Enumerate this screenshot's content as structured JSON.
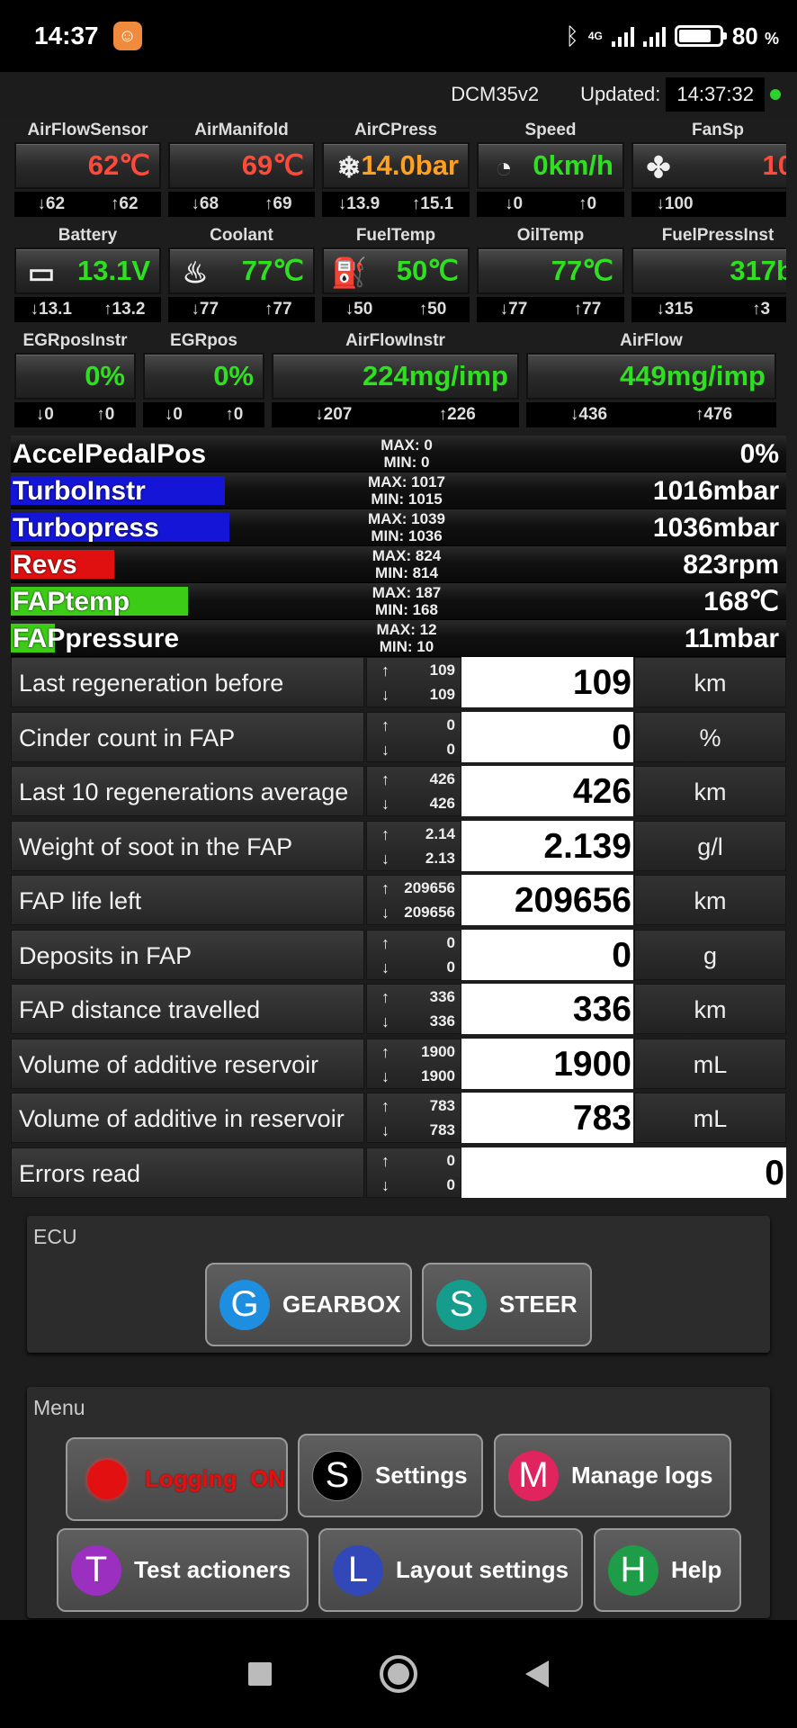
{
  "status_bar": {
    "time": "14:37",
    "app_icon": "orange-app-icon",
    "signal": "4G",
    "battery": "80",
    "battery_unit": "%"
  },
  "header": {
    "device": "DCM35v2",
    "updated_label": "Updated:",
    "updated_time": "14:37:32"
  },
  "gauge_rows": [
    [
      {
        "label": "AirFlowSensor",
        "value": "62℃",
        "min": "62",
        "max": "62",
        "color": "red",
        "icon": ""
      },
      {
        "label": "AirManifold",
        "value": "69℃",
        "min": "68",
        "max": "69",
        "color": "red",
        "icon": ""
      },
      {
        "label": "AirCPress",
        "value": "14.0bar",
        "min": "13.9",
        "max": "15.1",
        "color": "orange",
        "icon": "snowflake-icon"
      },
      {
        "label": "Speed",
        "value": "0km/h",
        "min": "0",
        "max": "0",
        "color": "green",
        "icon": "speedometer-icon"
      },
      {
        "label": "FanSp",
        "value": "10",
        "min": "100",
        "max": "",
        "color": "red",
        "icon": "fan-icon"
      }
    ],
    [
      {
        "label": "Battery",
        "value": "13.1V",
        "min": "13.1",
        "max": "13.2",
        "color": "green",
        "icon": "battery-icon"
      },
      {
        "label": "Coolant",
        "value": "77℃",
        "min": "77",
        "max": "77",
        "color": "green",
        "icon": "coolant-icon"
      },
      {
        "label": "FuelTemp",
        "value": "50℃",
        "min": "50",
        "max": "50",
        "color": "green",
        "icon": "fuel-pump-icon"
      },
      {
        "label": "OilTemp",
        "value": "77℃",
        "min": "77",
        "max": "77",
        "color": "green",
        "icon": ""
      },
      {
        "label": "FuelPressInst",
        "value": "317b",
        "min": "315",
        "max": "3",
        "color": "green",
        "icon": ""
      }
    ],
    [
      {
        "label": "EGRposInstr",
        "value": "0%",
        "min": "0",
        "max": "0",
        "color": "green",
        "icon": ""
      },
      {
        "label": "EGRpos",
        "value": "0%",
        "min": "0",
        "max": "0",
        "color": "green",
        "icon": ""
      },
      {
        "label": "AirFlowInstr",
        "value": "224mg/imp",
        "min": "207",
        "max": "226",
        "color": "green",
        "icon": ""
      },
      {
        "label": "AirFlow",
        "value": "449mg/imp",
        "min": "436",
        "max": "476",
        "color": "green",
        "icon": ""
      }
    ]
  ],
  "bars": [
    {
      "name": "AccelPedalPos",
      "max": "MAX: 0",
      "min": "MIN: 0",
      "value": "0%",
      "fill": 0.0,
      "color": "#1a1a1a"
    },
    {
      "name": "TurboInstr",
      "max": "MAX: 1017",
      "min": "MIN: 1015",
      "value": "1016mbar",
      "fill": 0.276,
      "color": "#1515d8"
    },
    {
      "name": "Turbopress",
      "max": "MAX: 1039",
      "min": "MIN: 1036",
      "value": "1036mbar",
      "fill": 0.282,
      "color": "#1515d8"
    },
    {
      "name": "Revs",
      "max": "MAX: 824",
      "min": "MIN: 814",
      "value": "823rpm",
      "fill": 0.133,
      "color": "#e01010"
    },
    {
      "name": "FAPtemp",
      "max": "MAX: 187",
      "min": "MIN: 168",
      "value": "168℃",
      "fill": 0.228,
      "color": "#3ccc18"
    },
    {
      "name": "FAPpressure",
      "max": "MAX: 12",
      "min": "MIN: 10",
      "value": "11mbar",
      "fill": 0.057,
      "color": "#3ccc18"
    }
  ],
  "params": [
    {
      "name": "Last regeneration before",
      "up": "109",
      "down": "109",
      "value": "109",
      "unit": "km"
    },
    {
      "name": "Cinder count in FAP",
      "up": "0",
      "down": "0",
      "value": "0",
      "unit": "%"
    },
    {
      "name": "Last 10 regenerations average",
      "up": "426",
      "down": "426",
      "value": "426",
      "unit": "km"
    },
    {
      "name": "Weight of soot in the FAP",
      "up": "2.14",
      "down": "2.13",
      "value": "2.139",
      "unit": "g/l"
    },
    {
      "name": "FAP life left",
      "up": "209656",
      "down": "209656",
      "value": "209656",
      "unit": "km"
    },
    {
      "name": "Deposits in FAP",
      "up": "0",
      "down": "0",
      "value": "0",
      "unit": "g"
    },
    {
      "name": "FAP distance travelled",
      "up": "336",
      "down": "336",
      "value": "336",
      "unit": "km"
    },
    {
      "name": "Volume of additive reservoir",
      "up": "1900",
      "down": "1900",
      "value": "1900",
      "unit": "mL"
    },
    {
      "name": "Volume of additive in reservoir",
      "up": "783",
      "down": "783",
      "value": "783",
      "unit": "mL"
    },
    {
      "name": "Errors read",
      "up": "0",
      "down": "0",
      "value": "0",
      "unit": ""
    }
  ],
  "ecu": {
    "title": "ECU",
    "buttons": [
      {
        "letter": "G",
        "label": "GEARBOX",
        "color": "#1e8fe0"
      },
      {
        "letter": "S",
        "label": "STEER",
        "color": "#169c8c"
      }
    ]
  },
  "menu": {
    "title": "Menu",
    "buttons": [
      {
        "letter": "",
        "label": "Logging  ON",
        "color": "#e21010",
        "text_color": "#e21010"
      },
      {
        "letter": "S",
        "label": "Settings",
        "color": "#000000",
        "text_color": "#ffffff"
      },
      {
        "letter": "M",
        "label": "Manage logs",
        "color": "#e0245e",
        "text_color": "#ffffff"
      },
      {
        "letter": "T",
        "label": "Test actioners",
        "color": "#9b2fc0",
        "text_color": "#ffffff"
      },
      {
        "letter": "L",
        "label": "Layout settings",
        "color": "#3348b8",
        "text_color": "#ffffff"
      },
      {
        "letter": "H",
        "label": "Help",
        "color": "#1e9c48",
        "text_color": "#ffffff"
      }
    ]
  }
}
